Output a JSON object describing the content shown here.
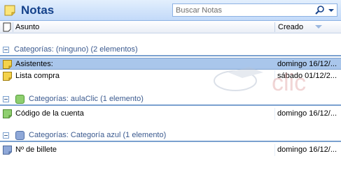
{
  "header": {
    "title": "Notas",
    "icon": "note-icon"
  },
  "search": {
    "placeholder": "Buscar Notas",
    "icon": "search-icon"
  },
  "columns": {
    "icon": "note-type-icon",
    "subject": "Asunto",
    "created": "Creado"
  },
  "groups": [
    {
      "label": "Categorías: (ninguno) (2 elementos)",
      "color": null,
      "items": [
        {
          "subject": "Asistentes:",
          "date": "domingo 16/12/...",
          "note_color": "#f4d24b",
          "selected": true
        },
        {
          "subject": "Lista compra",
          "date": "sábado 01/12/2...",
          "note_color": "#f4d24b",
          "selected": false
        }
      ]
    },
    {
      "label": "Categorías: aulaClic (1 elemento)",
      "color": "#8fcf6f",
      "items": [
        {
          "subject": "Código de la cuenta",
          "date": "domingo 16/12/...",
          "note_color": "#8fcf6f",
          "selected": false
        }
      ]
    },
    {
      "label": "Categorías: Categoría azul (1 elemento)",
      "color": "#8fa8d8",
      "items": [
        {
          "subject": "Nº de billete",
          "date": "domingo 16/12/...",
          "note_color": "#8fa8d8",
          "selected": false
        }
      ]
    }
  ],
  "watermark_text": "clic"
}
